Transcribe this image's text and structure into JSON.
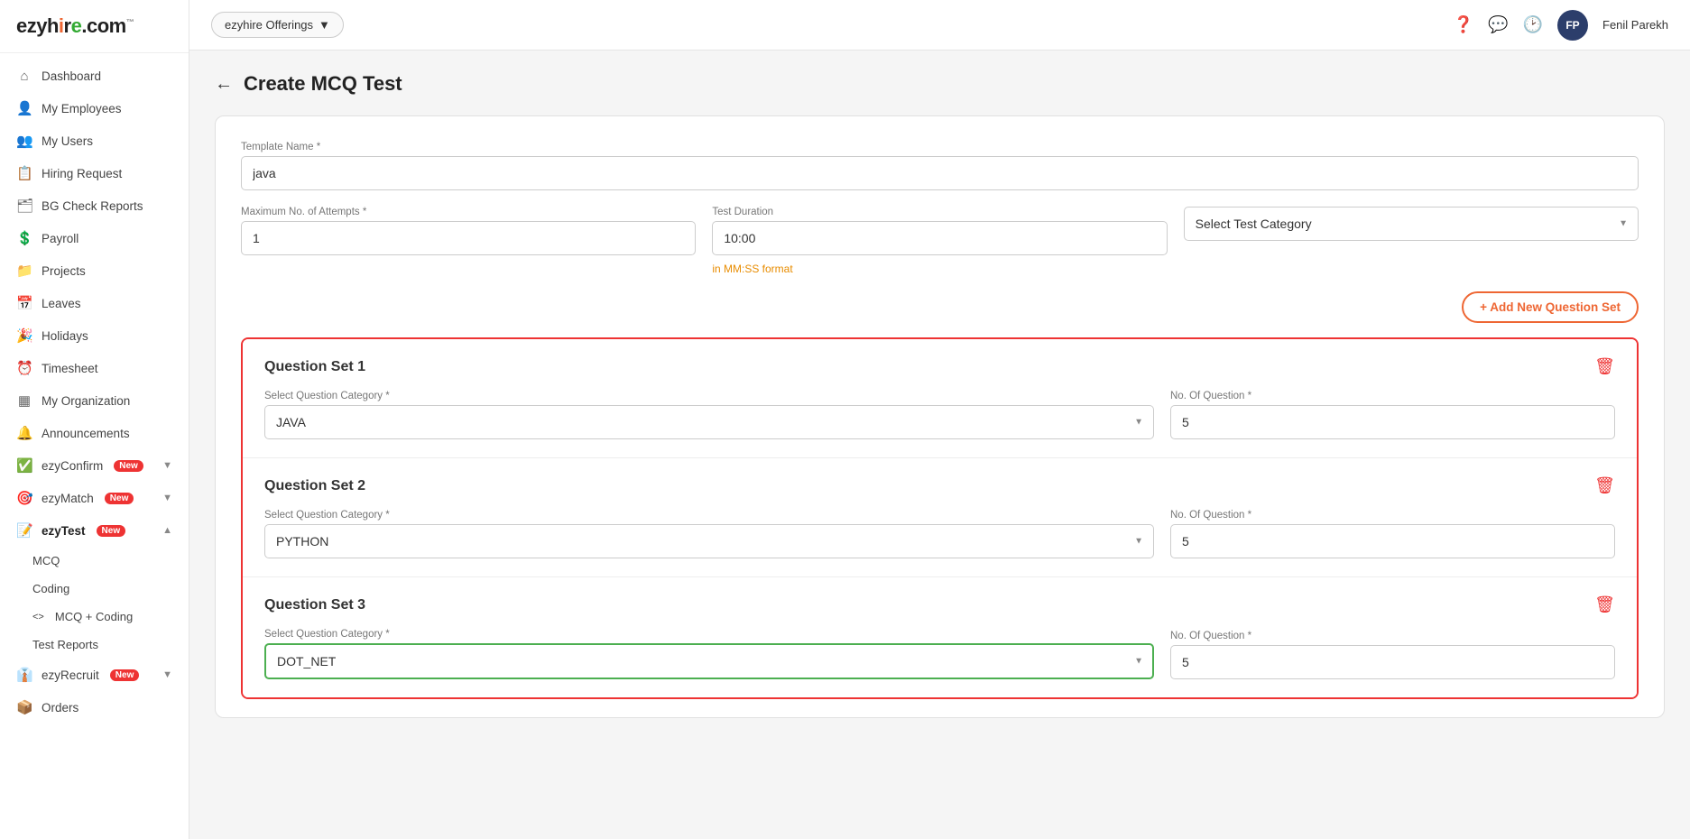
{
  "sidebar": {
    "logo": "ezyhire.com",
    "items": [
      {
        "id": "dashboard",
        "label": "Dashboard",
        "icon": "⌂",
        "active": false
      },
      {
        "id": "my-employees",
        "label": "My Employees",
        "icon": "👤",
        "active": false
      },
      {
        "id": "my-users",
        "label": "My Users",
        "icon": "👥",
        "active": false
      },
      {
        "id": "hiring-request",
        "label": "Hiring Request",
        "icon": "📋",
        "active": false
      },
      {
        "id": "bg-check-reports",
        "label": "BG Check Reports",
        "icon": "🗂",
        "active": false
      },
      {
        "id": "payroll",
        "label": "Payroll",
        "icon": "💲",
        "active": false
      },
      {
        "id": "projects",
        "label": "Projects",
        "icon": "📁",
        "active": false
      },
      {
        "id": "leaves",
        "label": "Leaves",
        "icon": "📅",
        "active": false
      },
      {
        "id": "holidays",
        "label": "Holidays",
        "icon": "🎉",
        "active": false
      },
      {
        "id": "timesheet",
        "label": "Timesheet",
        "icon": "⏰",
        "active": false
      },
      {
        "id": "my-organization",
        "label": "My Organization",
        "icon": "▦",
        "active": false
      },
      {
        "id": "announcements",
        "label": "Announcements",
        "icon": "🔔",
        "active": false
      },
      {
        "id": "ezyconfirm",
        "label": "ezyConfirm",
        "icon": "✅",
        "badge": "New",
        "active": false
      },
      {
        "id": "ezymatch",
        "label": "ezyMatch",
        "icon": "🎯",
        "badge": "New",
        "active": false
      },
      {
        "id": "ezytest",
        "label": "ezyTest",
        "icon": "📝",
        "badge": "New",
        "active": true,
        "expanded": true
      },
      {
        "id": "mcq",
        "label": "MCQ",
        "icon": "",
        "sub": true,
        "active": false
      },
      {
        "id": "coding",
        "label": "Coding",
        "icon": "",
        "sub": true,
        "active": false
      },
      {
        "id": "mcq-coding",
        "label": "MCQ + Coding",
        "icon": "<>",
        "sub": true,
        "active": false
      },
      {
        "id": "test-reports",
        "label": "Test Reports",
        "icon": "",
        "sub": true,
        "active": false
      },
      {
        "id": "ezyrecruit",
        "label": "ezyRecruit",
        "icon": "👔",
        "badge": "New",
        "active": false
      },
      {
        "id": "orders",
        "label": "Orders",
        "icon": "📦",
        "active": false
      }
    ]
  },
  "topbar": {
    "offerings_label": "ezyhire Offerings",
    "user_initials": "FP",
    "user_name": "Fenil Parekh"
  },
  "page": {
    "title": "Create MCQ Test"
  },
  "form": {
    "template_name_label": "Template Name *",
    "template_name_value": "java",
    "max_attempts_label": "Maximum No. of Attempts *",
    "max_attempts_value": "1",
    "test_duration_label": "Test Duration",
    "test_duration_value": "10:00",
    "duration_hint": "in MM:SS format",
    "test_category_label": "Select Test Category",
    "test_category_placeholder": "Select Test Category"
  },
  "add_qset_btn": "+ Add New Question Set",
  "question_sets": [
    {
      "id": 1,
      "title": "Question Set 1",
      "category_label": "Select Question Category *",
      "category_value": "JAVA",
      "count_label": "No. Of Question *",
      "count_value": "5",
      "active_border": false
    },
    {
      "id": 2,
      "title": "Question Set 2",
      "category_label": "Select Question Category *",
      "category_value": "PYTHON",
      "count_label": "No. Of Question *",
      "count_value": "5",
      "active_border": false
    },
    {
      "id": 3,
      "title": "Question Set 3",
      "category_label": "Select Question Category *",
      "category_value": "DOT_NET",
      "count_label": "No. Of Question *",
      "count_value": "5",
      "active_border": true
    }
  ]
}
